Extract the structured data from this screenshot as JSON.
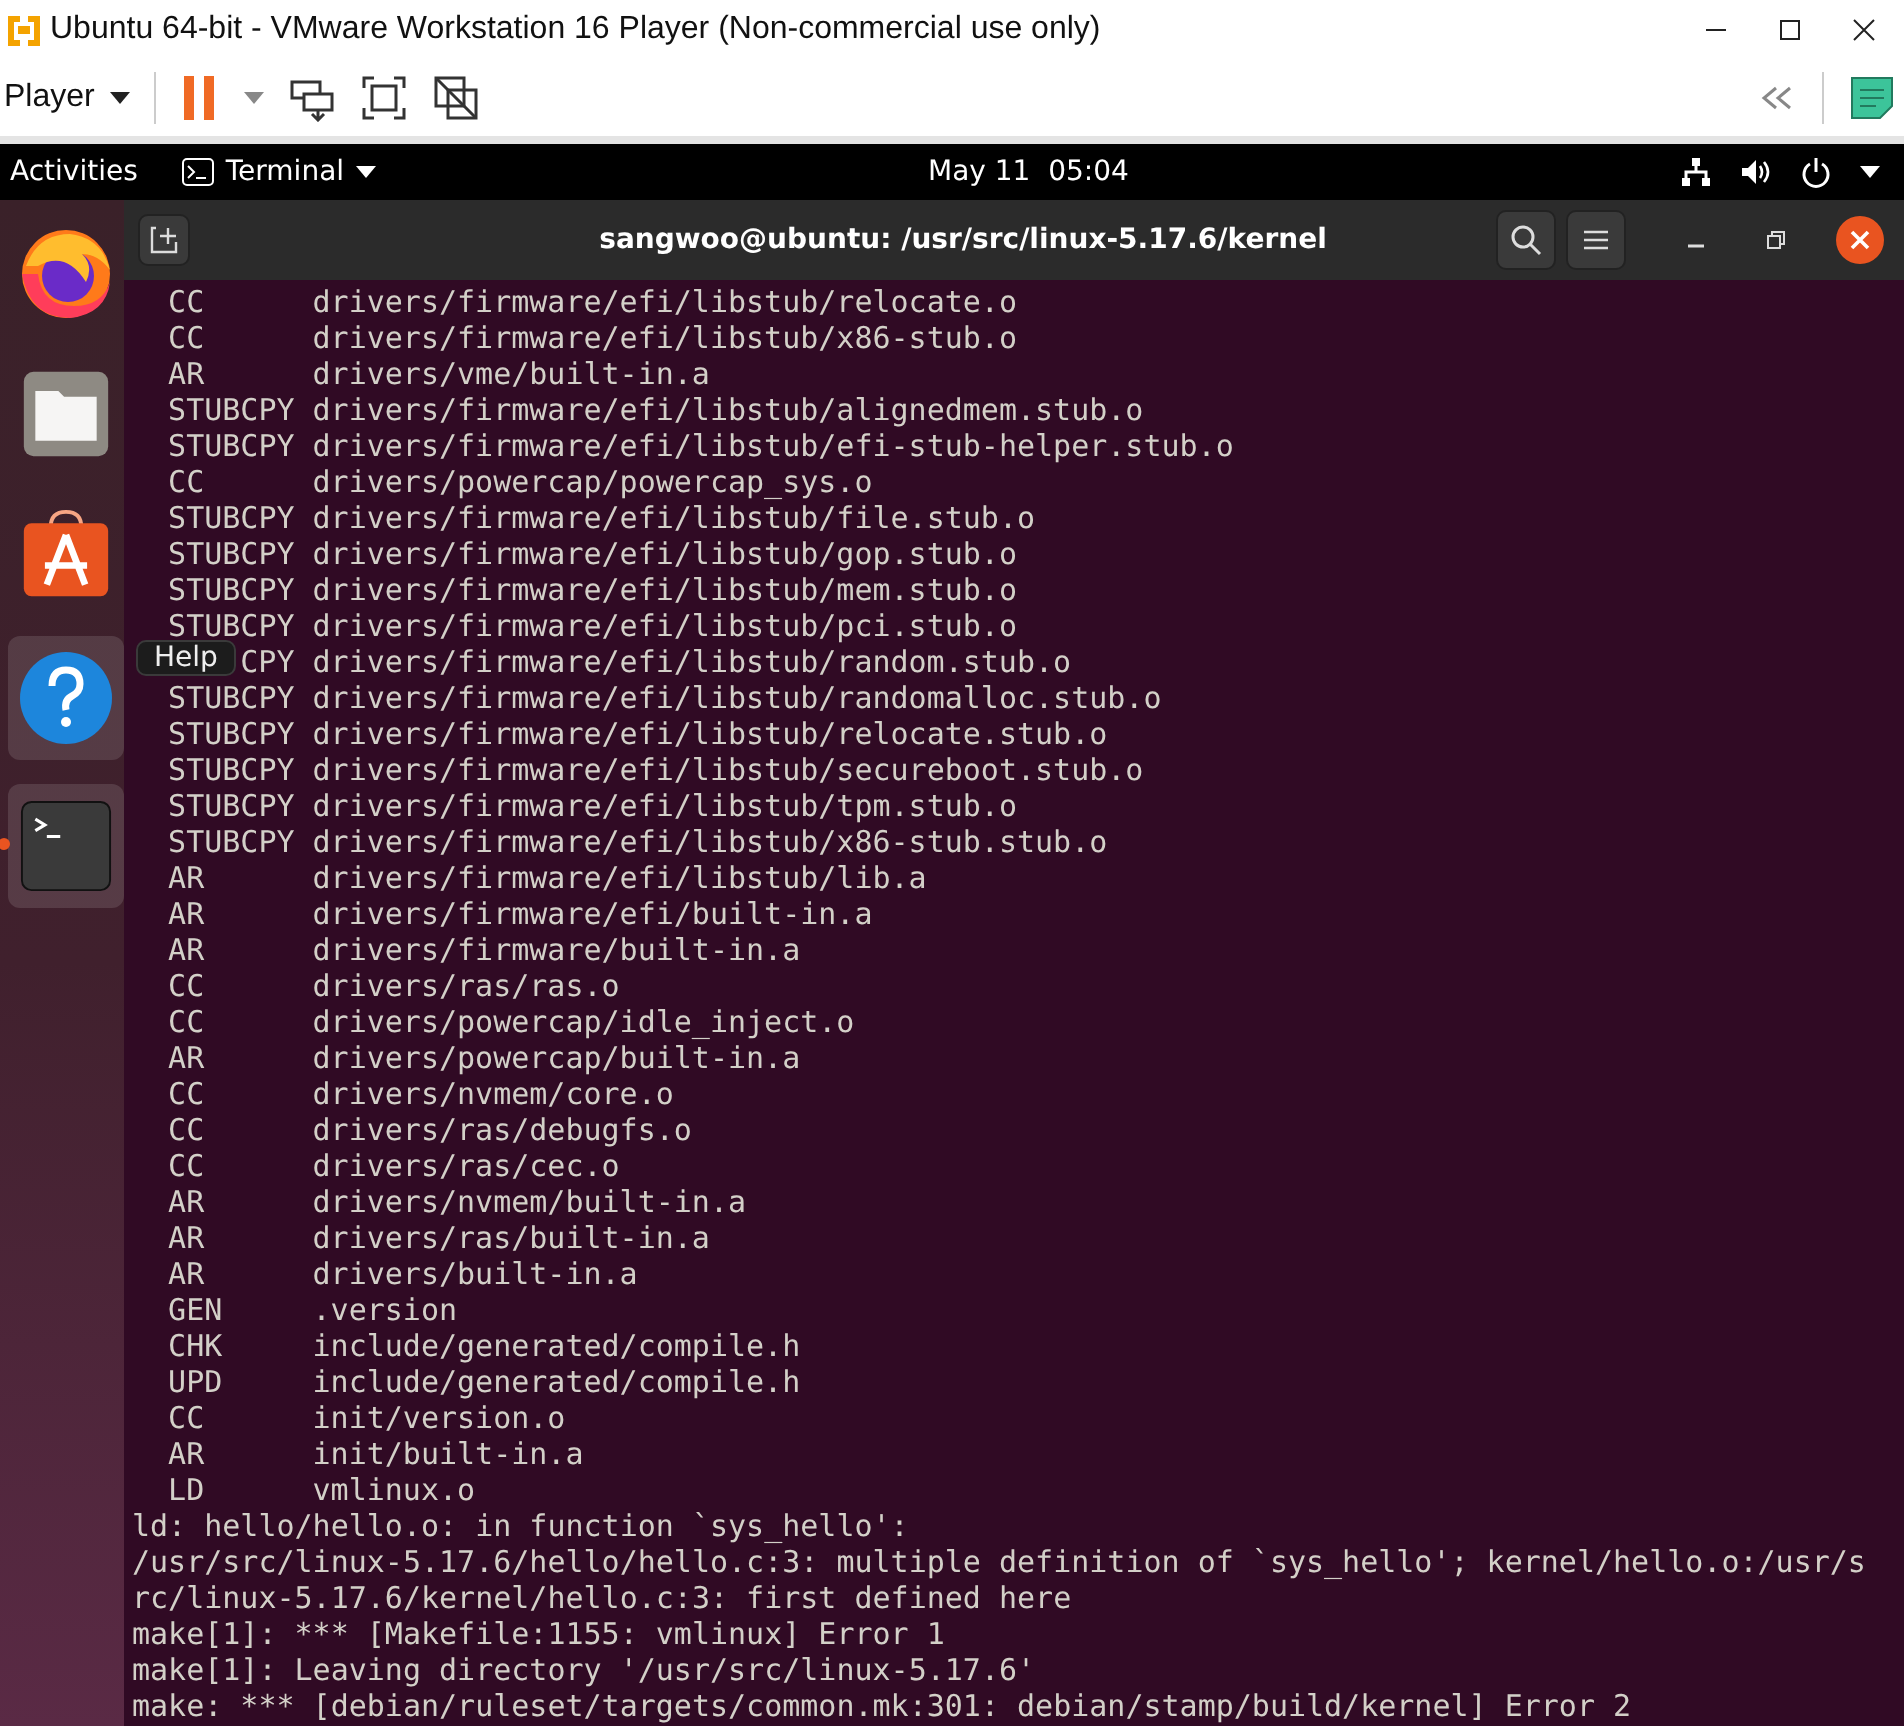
{
  "vm_window": {
    "title": "Ubuntu 64-bit - VMware Workstation 16 Player (Non-commercial use only)",
    "player_menu": "Player"
  },
  "top_bar": {
    "activities": "Activities",
    "app_menu": "Terminal",
    "clock": "May 11  05:04"
  },
  "dock": {
    "items": [
      {
        "kind": "firefox",
        "highlighted": false,
        "running": false
      },
      {
        "kind": "files",
        "highlighted": false,
        "running": false
      },
      {
        "kind": "software",
        "highlighted": false,
        "running": false
      },
      {
        "kind": "help",
        "highlighted": true,
        "running": false
      },
      {
        "kind": "terminal",
        "highlighted": true,
        "running": true
      }
    ],
    "tooltip": "Help"
  },
  "terminal": {
    "title": "sangwoo@ubuntu: /usr/src/linux-5.17.6/kernel",
    "lines": [
      {
        "kind": "build",
        "tag": "CC",
        "path": "drivers/firmware/efi/libstub/relocate.o"
      },
      {
        "kind": "build",
        "tag": "CC",
        "path": "drivers/firmware/efi/libstub/x86-stub.o"
      },
      {
        "kind": "build",
        "tag": "AR",
        "path": "drivers/vme/built-in.a"
      },
      {
        "kind": "build",
        "tag": "STUBCPY",
        "path": "drivers/firmware/efi/libstub/alignedmem.stub.o"
      },
      {
        "kind": "build",
        "tag": "STUBCPY",
        "path": "drivers/firmware/efi/libstub/efi-stub-helper.stub.o"
      },
      {
        "kind": "build",
        "tag": "CC",
        "path": "drivers/powercap/powercap_sys.o"
      },
      {
        "kind": "build",
        "tag": "STUBCPY",
        "path": "drivers/firmware/efi/libstub/file.stub.o"
      },
      {
        "kind": "build",
        "tag": "STUBCPY",
        "path": "drivers/firmware/efi/libstub/gop.stub.o"
      },
      {
        "kind": "build",
        "tag": "STUBCPY",
        "path": "drivers/firmware/efi/libstub/mem.stub.o"
      },
      {
        "kind": "build",
        "tag": "STUBCPY",
        "path": "drivers/firmware/efi/libstub/pci.stub.o"
      },
      {
        "kind": "build-covered",
        "tag": "CPY",
        "path": "drivers/firmware/efi/libstub/random.stub.o"
      },
      {
        "kind": "build",
        "tag": "STUBCPY",
        "path": "drivers/firmware/efi/libstub/randomalloc.stub.o"
      },
      {
        "kind": "build",
        "tag": "STUBCPY",
        "path": "drivers/firmware/efi/libstub/relocate.stub.o"
      },
      {
        "kind": "build",
        "tag": "STUBCPY",
        "path": "drivers/firmware/efi/libstub/secureboot.stub.o"
      },
      {
        "kind": "build",
        "tag": "STUBCPY",
        "path": "drivers/firmware/efi/libstub/tpm.stub.o"
      },
      {
        "kind": "build",
        "tag": "STUBCPY",
        "path": "drivers/firmware/efi/libstub/x86-stub.stub.o"
      },
      {
        "kind": "build",
        "tag": "AR",
        "path": "drivers/firmware/efi/libstub/lib.a"
      },
      {
        "kind": "build",
        "tag": "AR",
        "path": "drivers/firmware/efi/built-in.a"
      },
      {
        "kind": "build",
        "tag": "AR",
        "path": "drivers/firmware/built-in.a"
      },
      {
        "kind": "build",
        "tag": "CC",
        "path": "drivers/ras/ras.o"
      },
      {
        "kind": "build",
        "tag": "CC",
        "path": "drivers/powercap/idle_inject.o"
      },
      {
        "kind": "build",
        "tag": "AR",
        "path": "drivers/powercap/built-in.a"
      },
      {
        "kind": "build",
        "tag": "CC",
        "path": "drivers/nvmem/core.o"
      },
      {
        "kind": "build",
        "tag": "CC",
        "path": "drivers/ras/debugfs.o"
      },
      {
        "kind": "build",
        "tag": "CC",
        "path": "drivers/ras/cec.o"
      },
      {
        "kind": "build",
        "tag": "AR",
        "path": "drivers/nvmem/built-in.a"
      },
      {
        "kind": "build",
        "tag": "AR",
        "path": "drivers/ras/built-in.a"
      },
      {
        "kind": "build",
        "tag": "AR",
        "path": "drivers/built-in.a"
      },
      {
        "kind": "build",
        "tag": "GEN",
        "path": ".version"
      },
      {
        "kind": "build",
        "tag": "CHK",
        "path": "include/generated/compile.h"
      },
      {
        "kind": "build",
        "tag": "UPD",
        "path": "include/generated/compile.h"
      },
      {
        "kind": "build",
        "tag": "CC",
        "path": "init/version.o"
      },
      {
        "kind": "build",
        "tag": "AR",
        "path": "init/built-in.a"
      },
      {
        "kind": "build",
        "tag": "LD",
        "path": "vmlinux.o"
      },
      {
        "kind": "message",
        "text": "ld: hello/hello.o: in function `sys_hello':"
      },
      {
        "kind": "message",
        "text": "/usr/src/linux-5.17.6/hello/hello.c:3: multiple definition of `sys_hello'; kernel/hello.o:/usr/s"
      },
      {
        "kind": "message",
        "text": "rc/linux-5.17.6/kernel/hello.c:3: first defined here"
      },
      {
        "kind": "message",
        "text": "make[1]: *** [Makefile:1155: vmlinux] Error 1"
      },
      {
        "kind": "message",
        "text": "make[1]: Leaving directory '/usr/src/linux-5.17.6'"
      },
      {
        "kind": "message",
        "text": "make: *** [debian/ruleset/targets/common.mk:301: debian/stamp/build/kernel] Error 2"
      }
    ]
  }
}
